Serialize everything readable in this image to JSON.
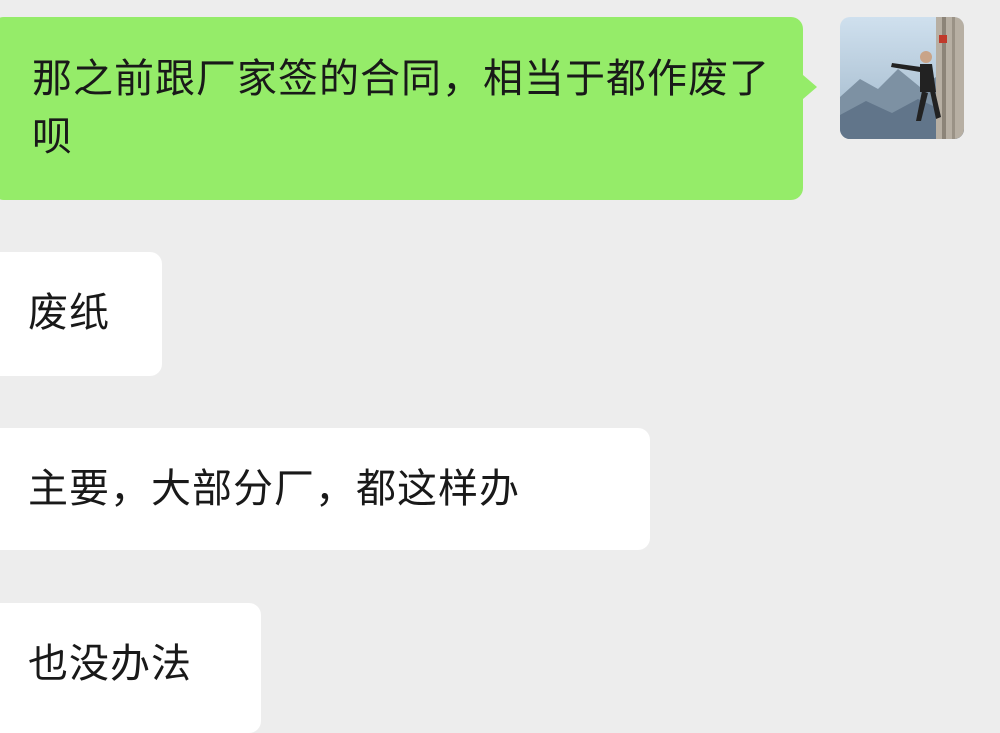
{
  "messages": [
    {
      "sender": "self",
      "text": "那之前跟厂家签的合同，相当于都作废了呗"
    },
    {
      "sender": "other",
      "text": "废纸"
    },
    {
      "sender": "other",
      "text": "主要，大部分厂，都这样办"
    },
    {
      "sender": "other",
      "text": "也没办法"
    }
  ],
  "colors": {
    "background": "#ededed",
    "sent_bubble": "#95ec69",
    "received_bubble": "#ffffff",
    "text": "#191919"
  }
}
